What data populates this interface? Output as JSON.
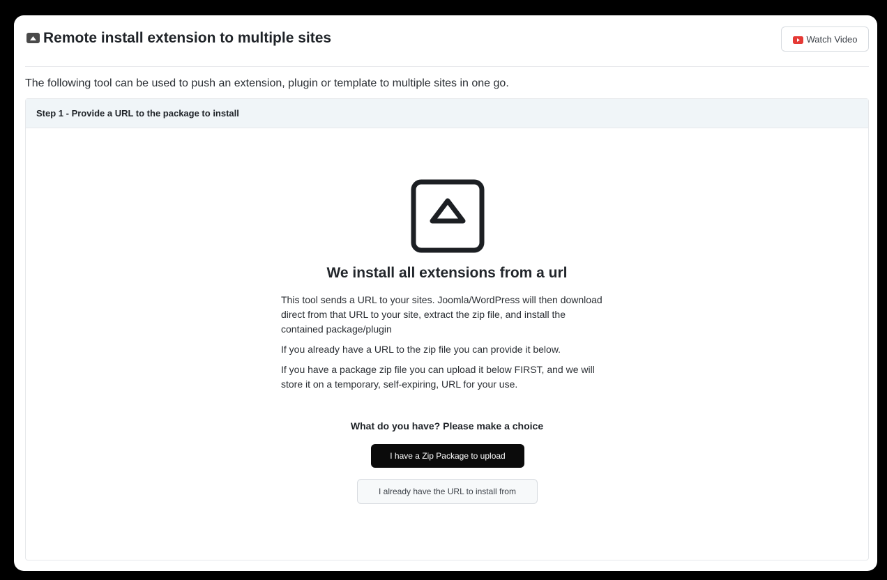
{
  "header": {
    "title": "Remote install extension to multiple sites",
    "collapse_icon": "caret-up-icon",
    "watch_video_label": "Watch Video",
    "video_icon": "youtube-icon",
    "video_icon_color": "#e53935"
  },
  "intro_text": "The following tool can be used to push an extension, plugin or template to multiple sites in one go.",
  "step": {
    "title": "Step 1 - Provide a URL to the package to install",
    "icon": "upload-triangle-icon",
    "headline": "We install all extensions from a url",
    "paragraphs": [
      "This tool sends a URL to your sites. Joomla/WordPress will then download direct from that URL to your site, extract the zip file, and install the contained package/plugin",
      "If you already have a URL to the zip file you can provide it below.",
      "If you have a package zip file you can upload it below FIRST, and we will store it on a temporary, self-expiring, URL for your use."
    ],
    "choice_prompt": "What do you have? Please make a choice",
    "zip_button_label": "I have a Zip Package to upload",
    "url_button_label": "I already have the URL to install from"
  }
}
